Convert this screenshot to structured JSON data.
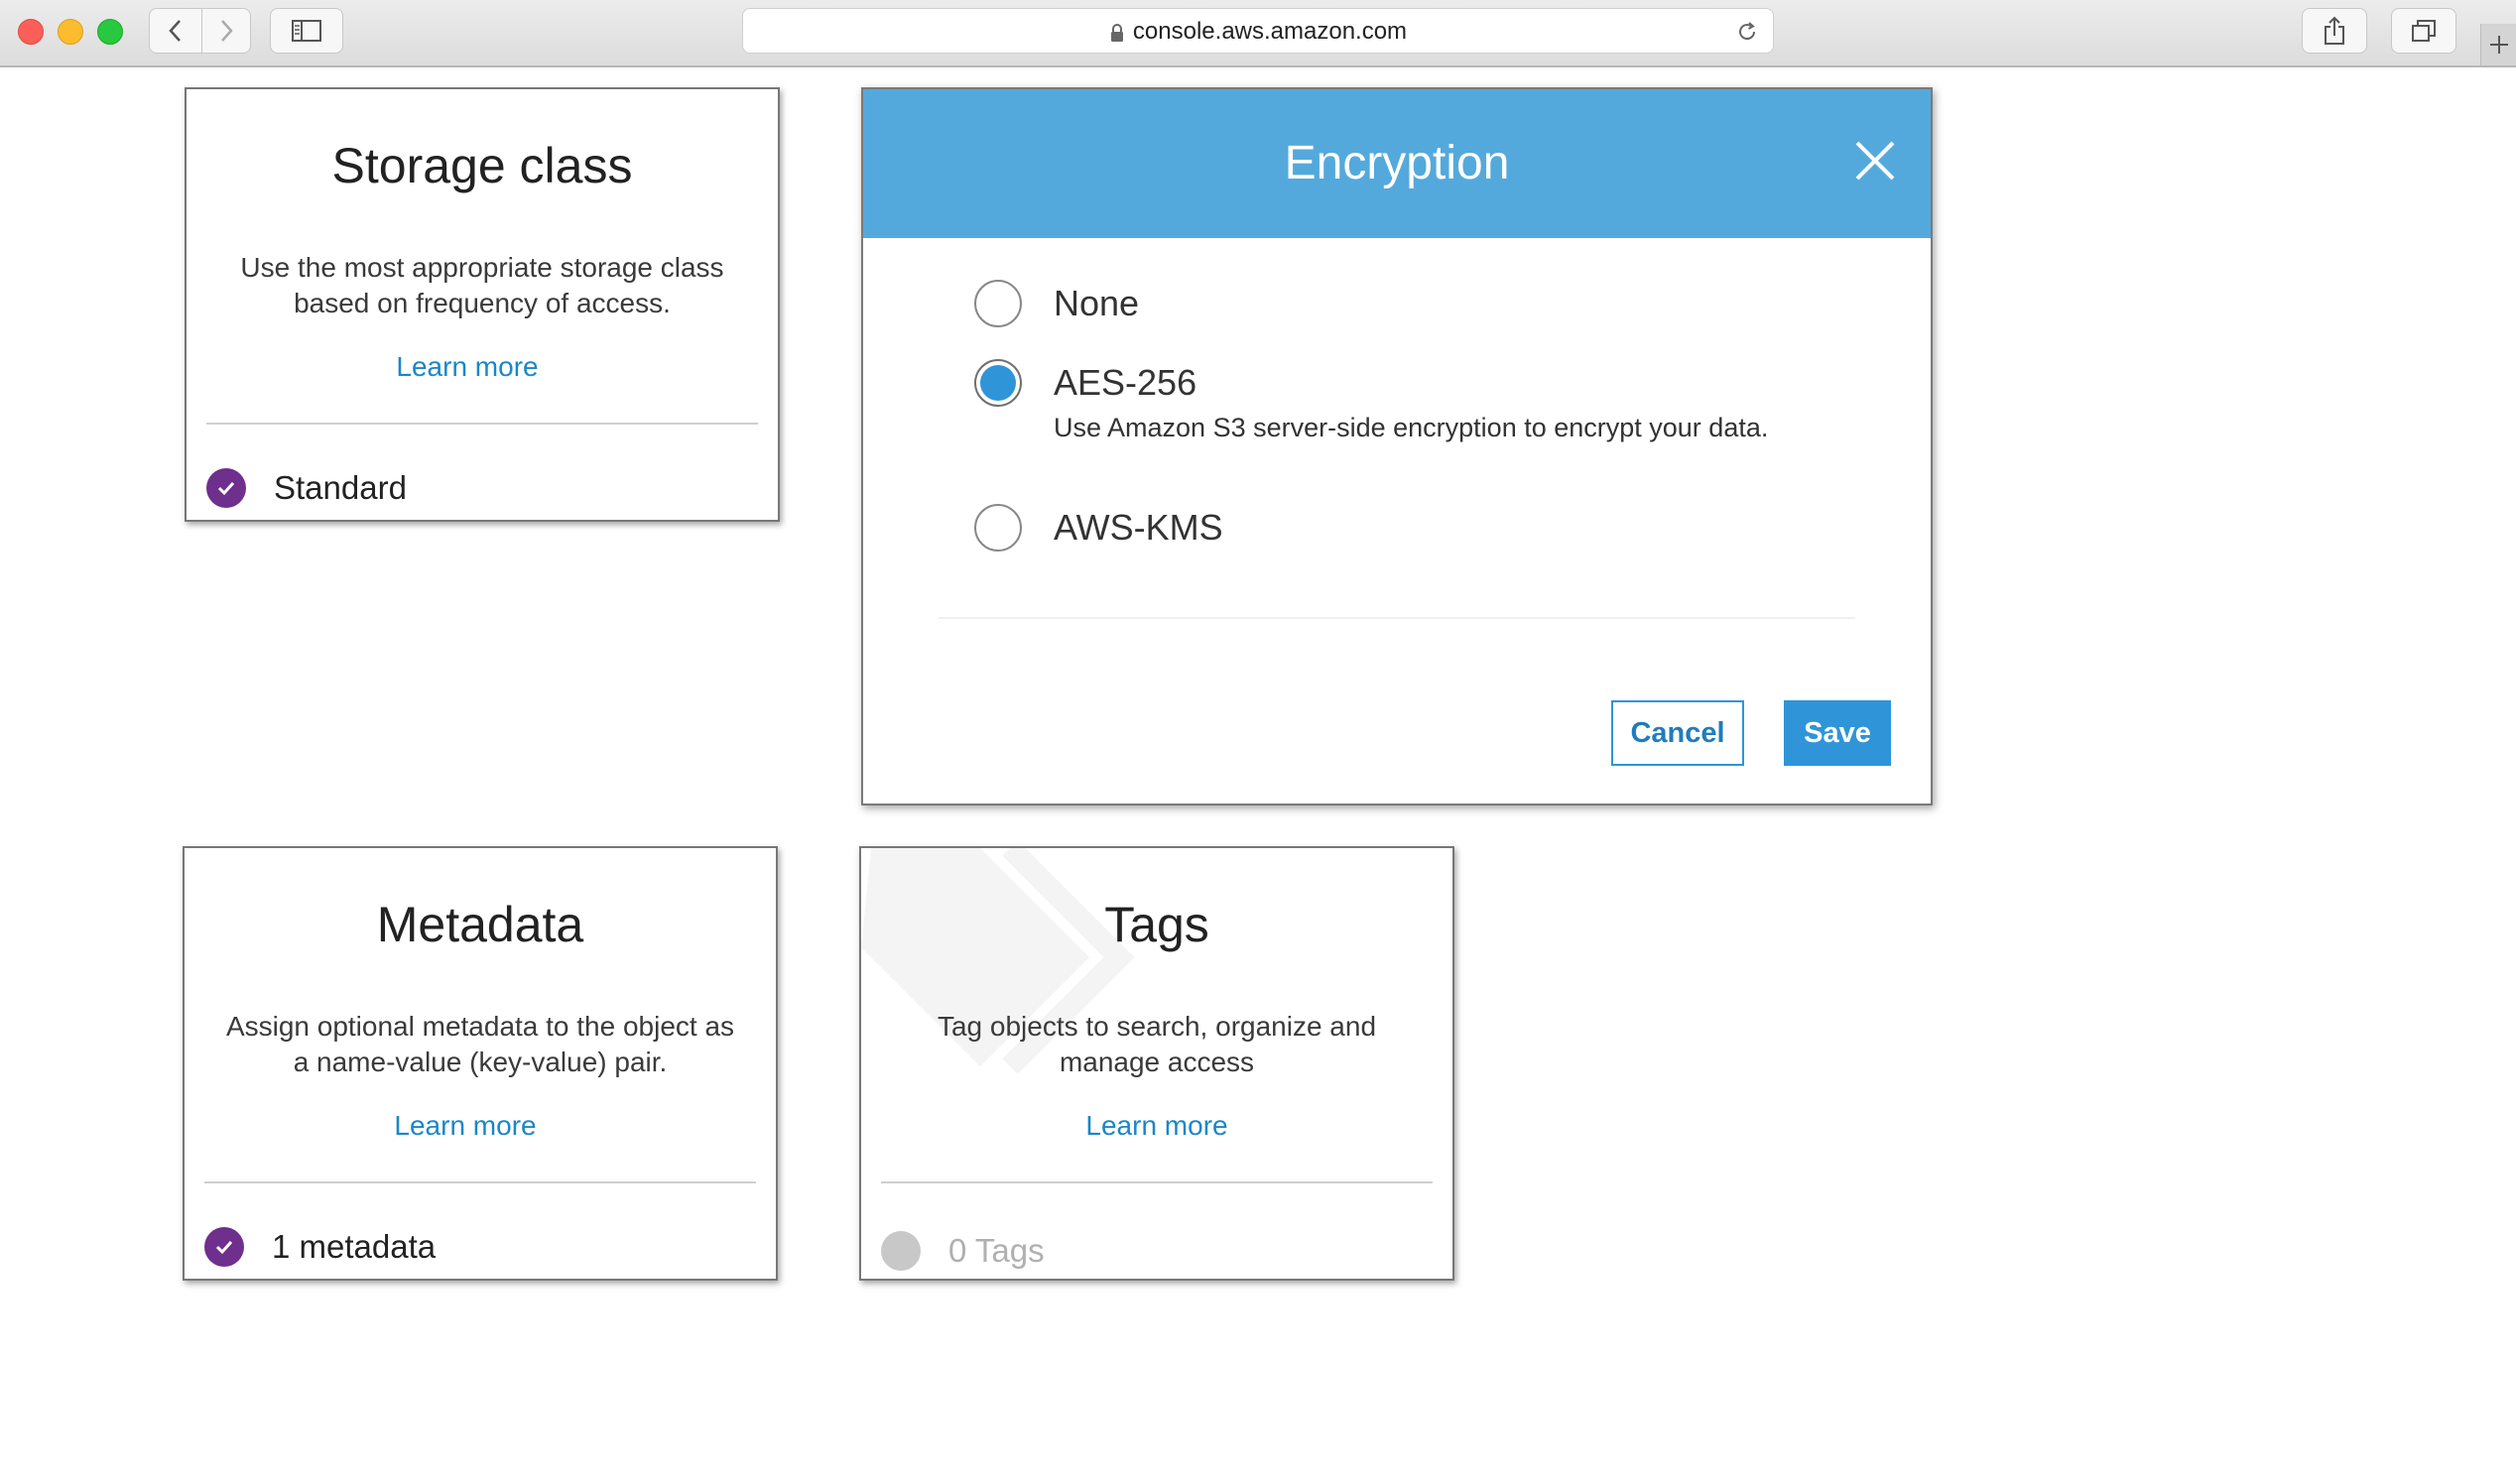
{
  "browser": {
    "url": "console.aws.amazon.com"
  },
  "storage_class": {
    "title": "Storage class",
    "description": "Use the most appropriate storage class based on frequency of access.",
    "learn_more": "Learn more",
    "status": "Standard"
  },
  "encryption_dialog": {
    "title": "Encryption",
    "options": [
      {
        "label": "None",
        "selected": false
      },
      {
        "label": "AES-256",
        "selected": true,
        "help": "Use Amazon S3 server-side encryption to encrypt your data."
      },
      {
        "label": "AWS-KMS",
        "selected": false
      }
    ],
    "cancel_label": "Cancel",
    "save_label": "Save"
  },
  "metadata": {
    "title": "Metadata",
    "description": "Assign optional metadata to the object as a name-value (key-value) pair.",
    "learn_more": "Learn more",
    "status": "1 metadata"
  },
  "tags": {
    "title": "Tags",
    "description": "Tag objects to search, organize and manage access",
    "learn_more": "Learn more",
    "status": "0 Tags"
  },
  "colors": {
    "dialog_header": "#54a9dc",
    "primary_button": "#2f95d8",
    "link": "#1a87c8",
    "check_badge": "#6f2f8c"
  }
}
